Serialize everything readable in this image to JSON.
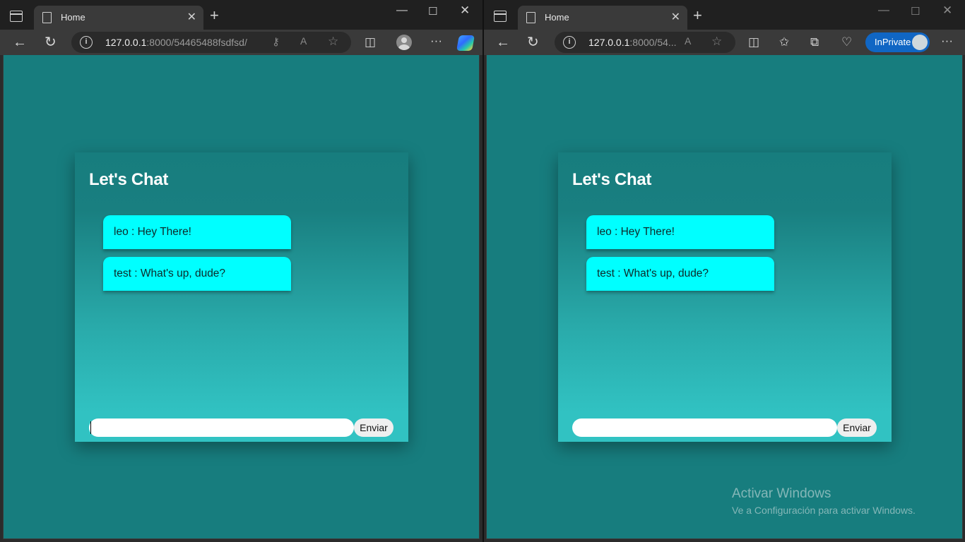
{
  "left_window": {
    "tab_title": "Home",
    "url_host": "127.0.0.1",
    "url_rest": ":8000/54465488fsdfsd/"
  },
  "right_window": {
    "tab_title": "Home",
    "url_host": "127.0.0.1",
    "url_rest": ":8000/54...",
    "inprivate_label": "InPrivate"
  },
  "chat": {
    "heading": "Let's Chat",
    "messages": [
      {
        "text": "leo : Hey There!"
      },
      {
        "text": "test : What's up, dude?"
      }
    ],
    "input_value": "",
    "input_placeholder": "",
    "send_label": "Enviar"
  },
  "watermark": {
    "title": "Activar Windows",
    "subtitle": "Ve a Configuración para activar Windows."
  },
  "colors": {
    "page_bg": "#177d7e",
    "message_bg": "#00ffff",
    "inprivate_badge": "#1066c4"
  }
}
